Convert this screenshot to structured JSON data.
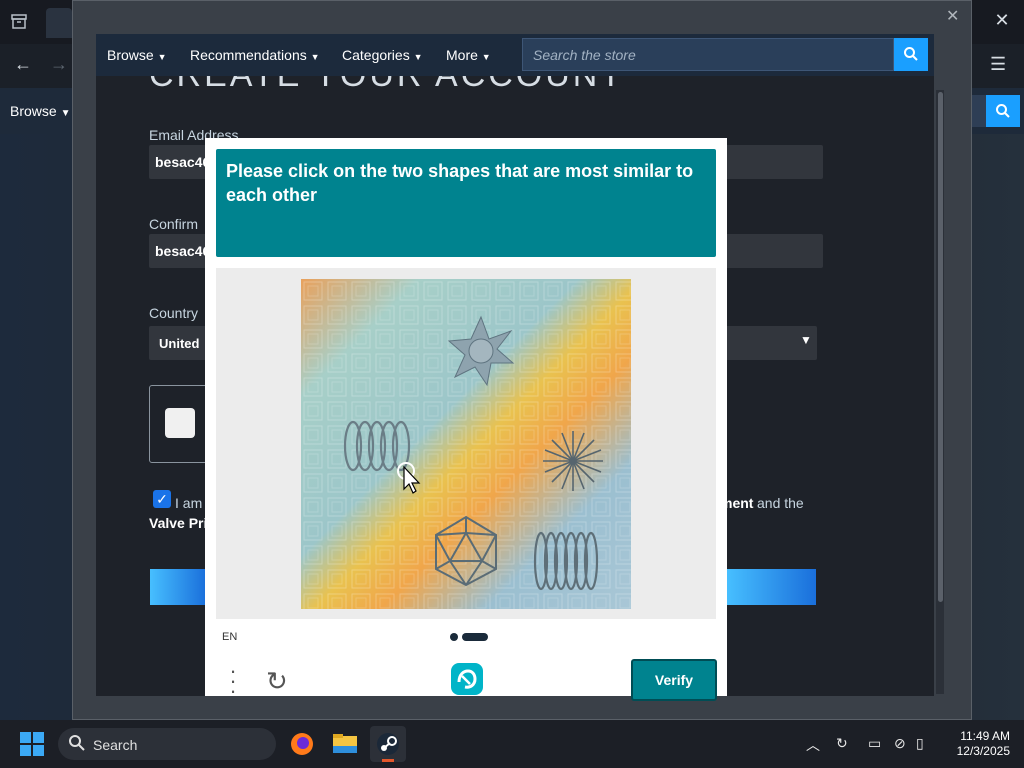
{
  "background_window": {
    "browse_label": "Browse"
  },
  "store_nav": {
    "items": [
      "Browse",
      "Recommendations",
      "Categories",
      "More"
    ],
    "search_placeholder": "Search the store"
  },
  "account_page": {
    "title": "CREATE YOUR ACCOUNT",
    "email_label": "Email Address",
    "email_value": "besac46",
    "confirm_label": "Confirm",
    "confirm_value": "besac46",
    "country_label": "Country",
    "country_value": "United",
    "agree_prefix": "I am",
    "agree_link": "ment",
    "agree_suffix": "and the",
    "valve_text": "Valve Pri"
  },
  "captcha": {
    "prompt": "Please click on the two shapes that are most similar to each other",
    "language": "EN",
    "verify_label": "Verify"
  },
  "taskbar": {
    "search_label": "Search",
    "time": "11:49 AM",
    "date": "12/3/2025"
  },
  "colors": {
    "captcha_teal": "#00838f",
    "steam_blue": "#1a9fff"
  }
}
